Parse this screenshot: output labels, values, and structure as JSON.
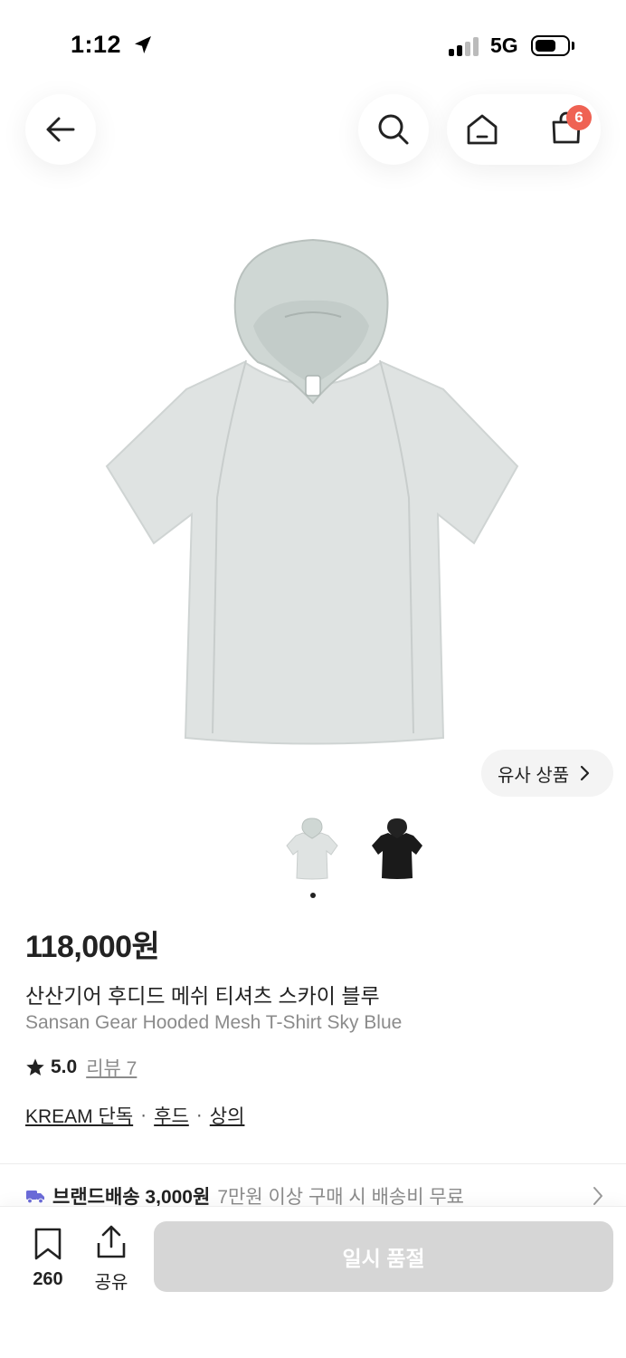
{
  "status_bar": {
    "time": "1:12",
    "network": "5G",
    "location_icon": "location-arrow-icon",
    "signal_icon": "cellular-signal-icon",
    "battery_icon": "battery-icon"
  },
  "header": {
    "back_icon": "arrow-left-icon",
    "search_icon": "search-icon",
    "home_icon": "home-icon",
    "cart_icon": "shopping-bag-icon",
    "cart_badge": "6"
  },
  "gallery": {
    "similar_button": "유사 상품",
    "thumbnails": [
      "sky-blue",
      "black"
    ],
    "active_index": 0,
    "thumbnail_colors": {
      "sky_blue": "#dfe3e2",
      "black": "#1a1a1a"
    }
  },
  "product": {
    "price": "118,000원",
    "name_ko": "산산기어 후디드 메쉬 티셔츠 스카이 블루",
    "name_en": "Sansan Gear Hooded Mesh T-Shirt Sky Blue",
    "rating": "5.0",
    "review_link": "리뷰 7",
    "tags": [
      "KREAM 단독",
      "후드",
      "상의"
    ],
    "tag_separator": "·"
  },
  "delivery": {
    "icon": "truck-icon",
    "main": "브랜드배송 3,000원",
    "sub": "7만원 이상 구매 시 배송비 무료"
  },
  "bottom_bar": {
    "bookmark_icon": "bookmark-icon",
    "bookmark_count": "260",
    "share_icon": "share-icon",
    "share_label": "공유",
    "action_label": "일시 품절"
  },
  "colors": {
    "accent_badge": "#ef6253",
    "delivery_icon": "#6b6bd8",
    "disabled_button": "#d6d6d6"
  }
}
